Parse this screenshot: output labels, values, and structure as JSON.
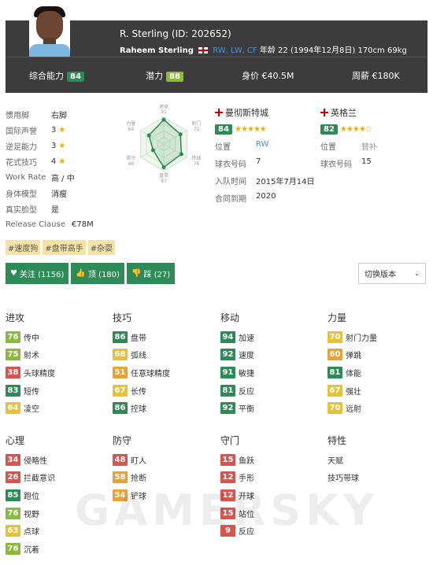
{
  "player": {
    "name_id": "R. Sterling (ID: 202652)",
    "fullname": "Raheem Sterling",
    "positions": "RW, LW, CF",
    "details": "年龄 22 (1994年12月8日) 170cm 69kg"
  },
  "stats": {
    "overall_label": "综合能力",
    "overall": "84",
    "potential_label": "潜力",
    "potential": "88",
    "value_label": "身价",
    "value": "€40.5M",
    "wage_label": "周薪",
    "wage": "€180K"
  },
  "info": [
    {
      "label": "惯用脚",
      "value": "右脚",
      "star": false
    },
    {
      "label": "国际声誉",
      "value": "3",
      "star": true
    },
    {
      "label": "逆足能力",
      "value": "3",
      "star": true
    },
    {
      "label": "花式技巧",
      "value": "4",
      "star": true
    },
    {
      "label": "Work Rate",
      "value": "高 / 中",
      "star": false
    },
    {
      "label": "身体模型",
      "value": "消瘦",
      "star": false
    },
    {
      "label": "真实脸型",
      "value": "是",
      "star": false
    },
    {
      "label": "Release Clause",
      "value": "€78M",
      "star": false
    }
  ],
  "tags": [
    "#速度狗",
    "#盘带高手",
    "#杂耍"
  ],
  "buttons": {
    "follow": "关注 (1156)",
    "up": "顶 (180)",
    "down": "踩 (27)",
    "version": "切换版本"
  },
  "radar": {
    "labels": [
      "速度",
      "射门",
      "传球",
      "盘带",
      "防守",
      "力量"
    ],
    "values": [
      "91",
      "72",
      "76",
      "87",
      "46",
      "64"
    ]
  },
  "club": {
    "name": "曼彻斯特城",
    "rating": "84",
    "stars": "★★★★★",
    "rows": [
      {
        "label": "位置",
        "value": "RW"
      },
      {
        "label": "球衣号码",
        "value": "7"
      },
      {
        "label": "入队时间",
        "value": "2015年7月14日"
      },
      {
        "label": "合同到期",
        "value": "2020"
      }
    ]
  },
  "national": {
    "name": "英格兰",
    "rating": "82",
    "stars": "★★★★☆",
    "rows": [
      {
        "label": "位置",
        "value": "替补"
      },
      {
        "label": "球衣号码",
        "value": "15"
      }
    ]
  },
  "attributes": {
    "attack": {
      "title": "进攻",
      "items": [
        {
          "v": "76",
          "n": "传中",
          "c": "#8ab93c"
        },
        {
          "v": "75",
          "n": "射术",
          "c": "#8ab93c"
        },
        {
          "v": "38",
          "n": "头球精度",
          "c": "#d9534f"
        },
        {
          "v": "83",
          "n": "短传",
          "c": "#2e8b57"
        },
        {
          "v": "64",
          "n": "凌空",
          "c": "#e8c236"
        }
      ]
    },
    "skill": {
      "title": "技巧",
      "items": [
        {
          "v": "86",
          "n": "盘带",
          "c": "#2e8b57"
        },
        {
          "v": "68",
          "n": "弧线",
          "c": "#e8c236"
        },
        {
          "v": "51",
          "n": "任意球精度",
          "c": "#e8a236"
        },
        {
          "v": "67",
          "n": "长传",
          "c": "#e8c236"
        },
        {
          "v": "86",
          "n": "控球",
          "c": "#2e8b57"
        }
      ]
    },
    "movement": {
      "title": "移动",
      "items": [
        {
          "v": "94",
          "n": "加速",
          "c": "#2e8b57"
        },
        {
          "v": "92",
          "n": "速度",
          "c": "#2e8b57"
        },
        {
          "v": "91",
          "n": "敏捷",
          "c": "#2e8b57"
        },
        {
          "v": "81",
          "n": "反应",
          "c": "#2e8b57"
        },
        {
          "v": "92",
          "n": "平衡",
          "c": "#2e8b57"
        }
      ]
    },
    "power": {
      "title": "力量",
      "items": [
        {
          "v": "70",
          "n": "射门力量",
          "c": "#e8c236"
        },
        {
          "v": "60",
          "n": "弹跳",
          "c": "#e8a236"
        },
        {
          "v": "81",
          "n": "体能",
          "c": "#2e8b57"
        },
        {
          "v": "67",
          "n": "强壮",
          "c": "#e8c236"
        },
        {
          "v": "70",
          "n": "远射",
          "c": "#e8c236"
        }
      ]
    },
    "mental": {
      "title": "心理",
      "items": [
        {
          "v": "34",
          "n": "侵略性",
          "c": "#d9534f"
        },
        {
          "v": "26",
          "n": "拦截意识",
          "c": "#d9534f"
        },
        {
          "v": "85",
          "n": "跑位",
          "c": "#2e8b57"
        },
        {
          "v": "76",
          "n": "视野",
          "c": "#8ab93c"
        },
        {
          "v": "63",
          "n": "点球",
          "c": "#e8c236"
        },
        {
          "v": "76",
          "n": "沉着",
          "c": "#8ab93c"
        }
      ]
    },
    "defending": {
      "title": "防守",
      "items": [
        {
          "v": "48",
          "n": "盯人",
          "c": "#d9534f"
        },
        {
          "v": "58",
          "n": "抢断",
          "c": "#e8a236"
        },
        {
          "v": "54",
          "n": "铲球",
          "c": "#e8a236"
        }
      ]
    },
    "goalkeeping": {
      "title": "守门",
      "items": [
        {
          "v": "15",
          "n": "鱼跃",
          "c": "#d9534f"
        },
        {
          "v": "12",
          "n": "手形",
          "c": "#d9534f"
        },
        {
          "v": "12",
          "n": "开球",
          "c": "#d9534f"
        },
        {
          "v": "15",
          "n": "站位",
          "c": "#d9534f"
        },
        {
          "v": "9",
          "n": "反应",
          "c": "#d9534f"
        }
      ]
    },
    "traits": {
      "title": "特性",
      "sub": "天赋",
      "items": [
        "技巧带球"
      ]
    }
  },
  "watermark": "GAMERSKY"
}
